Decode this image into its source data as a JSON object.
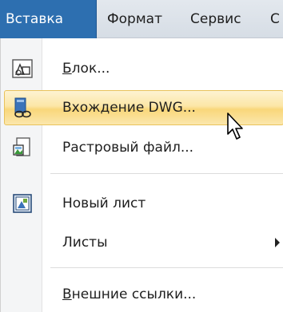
{
  "menubar": {
    "items": [
      {
        "label": "Вставка",
        "active": true
      },
      {
        "label": "Формат",
        "active": false
      },
      {
        "label": "Сервис",
        "active": false
      },
      {
        "label": "С",
        "active": false
      }
    ]
  },
  "dropdown": {
    "items": [
      {
        "label": "Блок...",
        "icon": "block-insert-icon"
      },
      {
        "label": "Вхождение DWG...",
        "icon": "dwg-reference-icon",
        "highlighted": true
      },
      {
        "label": "Растровый файл...",
        "icon": "raster-image-icon"
      },
      {
        "label": "Новый лист",
        "icon": "new-sheet-icon"
      },
      {
        "label": "Листы",
        "icon": "",
        "submenu": true
      },
      {
        "label": "Внешние ссылки...",
        "icon": ""
      }
    ]
  },
  "colors": {
    "active_menu": "#2d6fb0",
    "highlight_border": "#e9c25a",
    "highlight_fill": "#fce6a6"
  }
}
